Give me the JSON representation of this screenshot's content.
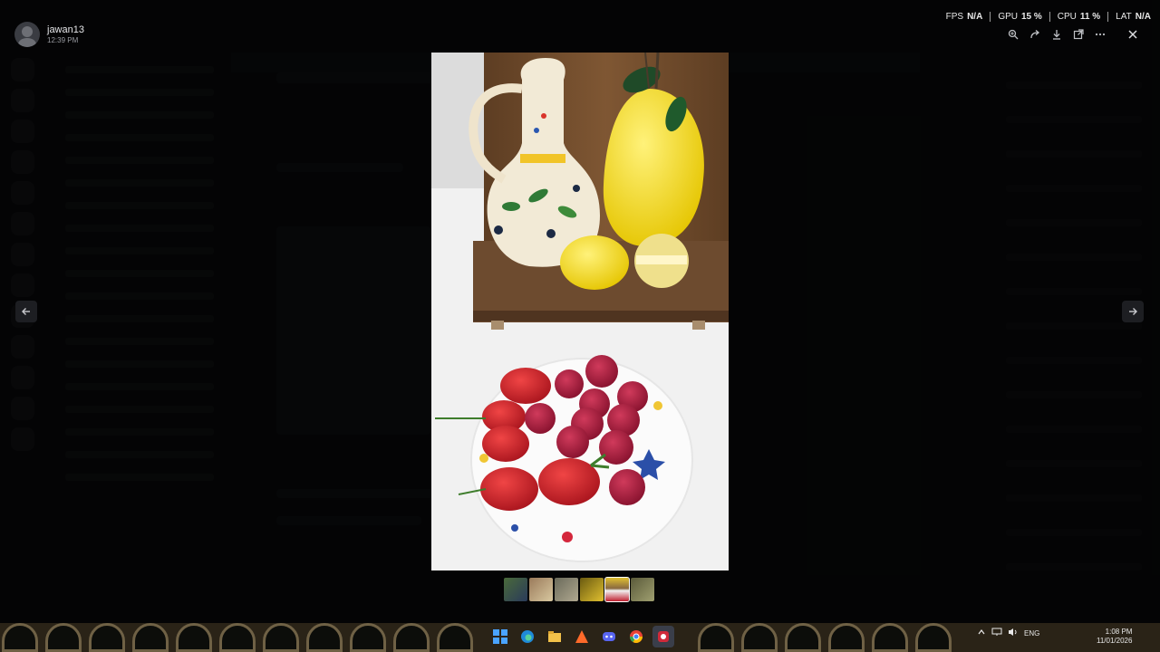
{
  "user": {
    "name": "jawan13",
    "time": "12:39 PM"
  },
  "stats": [
    {
      "label": "FPS",
      "value": "N/A"
    },
    {
      "label": "GPU",
      "value": "15 %"
    },
    {
      "label": "CPU",
      "value": "11 %"
    },
    {
      "label": "LAT",
      "value": "N/A"
    }
  ],
  "toolbar": {
    "zoom_icon": "zoom-in-icon",
    "forward_icon": "forward-icon",
    "download_icon": "download-icon",
    "open_icon": "open-external-icon",
    "more_icon": "more-icon",
    "close_icon": "close-icon"
  },
  "lightbox": {
    "prev_icon": "arrow-left-icon",
    "next_icon": "arrow-right-icon",
    "thumbnail_count": 6,
    "active_thumbnail": 5
  },
  "taskbar": {
    "language": "ENG",
    "clock_time": "1:08 PM",
    "clock_date": "11/01/2026"
  },
  "colors": {
    "overlay": "#050506",
    "accent_white": "#ffffff",
    "taskbar_gold": "#6f6145"
  }
}
